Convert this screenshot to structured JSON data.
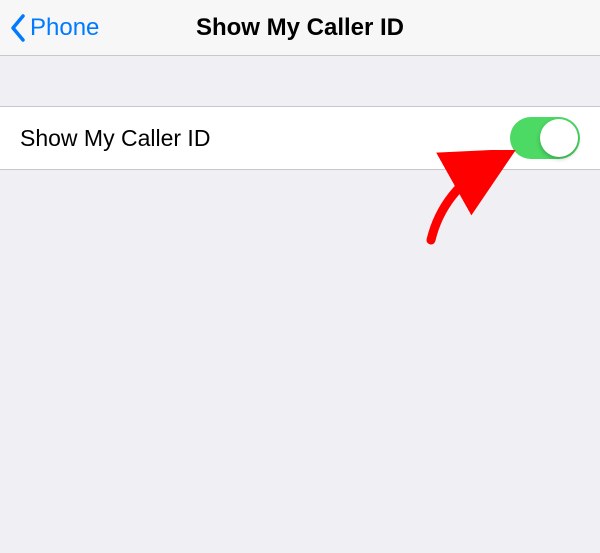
{
  "nav": {
    "back_label": "Phone",
    "title": "Show My Caller ID"
  },
  "settings": {
    "row": {
      "label": "Show My Caller ID",
      "toggle_on": true
    }
  },
  "colors": {
    "accent": "#007aff",
    "toggle_on": "#4cd964",
    "background": "#efeff4",
    "separator": "#c8c7cc",
    "annotation": "#ff0000"
  }
}
